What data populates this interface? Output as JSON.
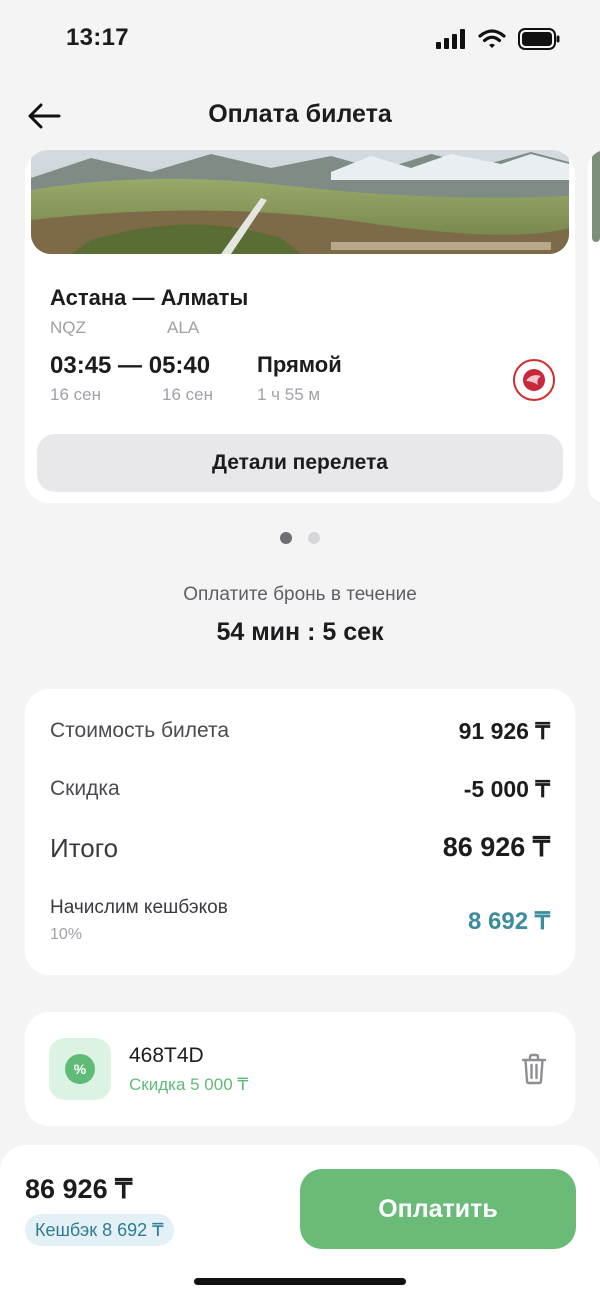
{
  "status_bar": {
    "time": "13:17"
  },
  "header": {
    "title": "Оплата билета"
  },
  "flight": {
    "route": "Астана — Алматы",
    "from_code": "NQZ",
    "to_code": "ALA",
    "times": "03:45 — 05:40",
    "departure_date": "16 сен",
    "arrival_date": "16 сен",
    "stops": "Прямой",
    "duration": "1 ч 55 м",
    "details_button": "Детали перелета"
  },
  "carousel": {
    "pages": 2,
    "active_index": 0
  },
  "timer": {
    "label": "Оплатите бронь в течение",
    "value": "54 мин : 5 сек"
  },
  "price": {
    "ticket_label": "Стоимость билета",
    "ticket_value": "91 926 ₸",
    "discount_label": "Скидка",
    "discount_value": "-5 000 ₸",
    "total_label": "Итого",
    "total_value": "86 926 ₸",
    "cashback_label": "Начислим кешбэков",
    "cashback_percent": "10%",
    "cashback_value": "8 692 ₸"
  },
  "promo": {
    "code": "468T4D",
    "discount_text": "Скидка 5 000 ₸"
  },
  "bottom_bar": {
    "total": "86 926 ₸",
    "cashback_pill": "Кешбэк 8 692 ₸",
    "pay_button": "Оплатить"
  },
  "icons": {
    "back": "arrow-left-icon",
    "signal": "cellular-signal-icon",
    "wifi": "wifi-icon",
    "battery": "battery-icon",
    "airline": "airline-logo-icon",
    "promo": "percent-icon",
    "delete": "trash-icon"
  },
  "colors": {
    "accent_green": "#6aba78",
    "cashback_blue": "#3c8c9c",
    "background": "#f4f4f5"
  }
}
